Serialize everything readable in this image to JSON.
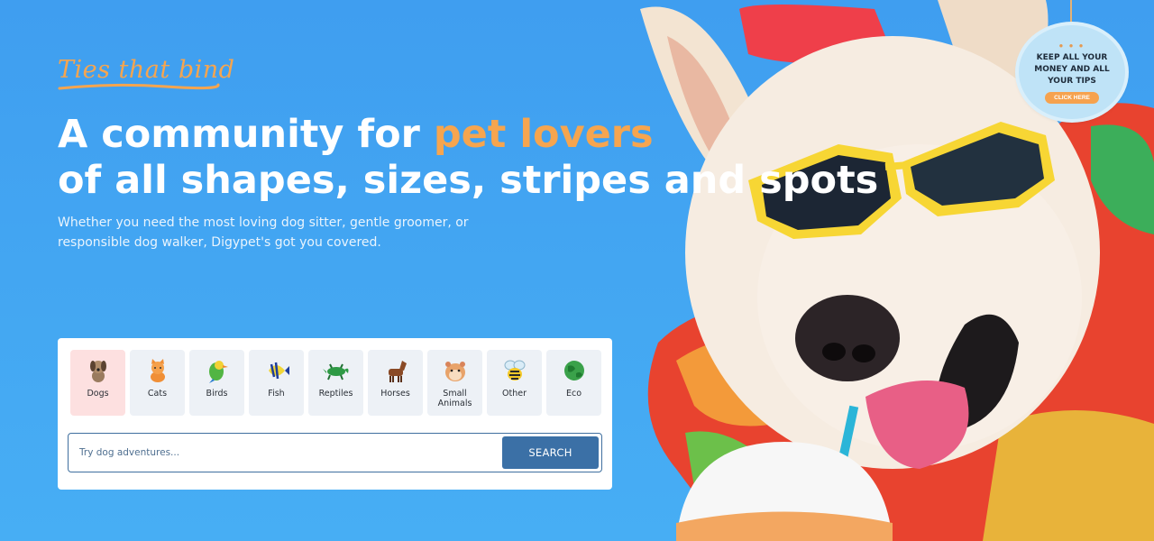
{
  "tagline": "Ties that bind",
  "headline": {
    "line1_prefix": "A community for ",
    "line1_accent": "pet lovers",
    "line2": "of all shapes, sizes, stripes and spots"
  },
  "subtext": "Whether you need the most loving dog sitter, gentle groomer, or responsible dog walker, Digypet's got you covered.",
  "badge": {
    "text": "KEEP ALL YOUR MONEY AND ALL YOUR TIPS",
    "button": "CLICK HERE"
  },
  "categories": [
    {
      "label": "Dogs",
      "icon": "dog-icon",
      "active": true
    },
    {
      "label": "Cats",
      "icon": "cat-icon",
      "active": false
    },
    {
      "label": "Birds",
      "icon": "bird-icon",
      "active": false
    },
    {
      "label": "Fish",
      "icon": "fish-icon",
      "active": false
    },
    {
      "label": "Reptiles",
      "icon": "reptile-icon",
      "active": false
    },
    {
      "label": "Horses",
      "icon": "horse-icon",
      "active": false
    },
    {
      "label": "Small Animals",
      "icon": "hamster-icon",
      "active": false
    },
    {
      "label": "Other",
      "icon": "bee-icon",
      "active": false
    },
    {
      "label": "Eco",
      "icon": "globe-icon",
      "active": false
    }
  ],
  "search": {
    "placeholder": "Try dog adventures...",
    "button": "SEARCH"
  },
  "colors": {
    "background": "#3f9ef0",
    "accent": "#f6a54f",
    "search_button": "#3b70a6",
    "active_category": "#fde0e0"
  }
}
